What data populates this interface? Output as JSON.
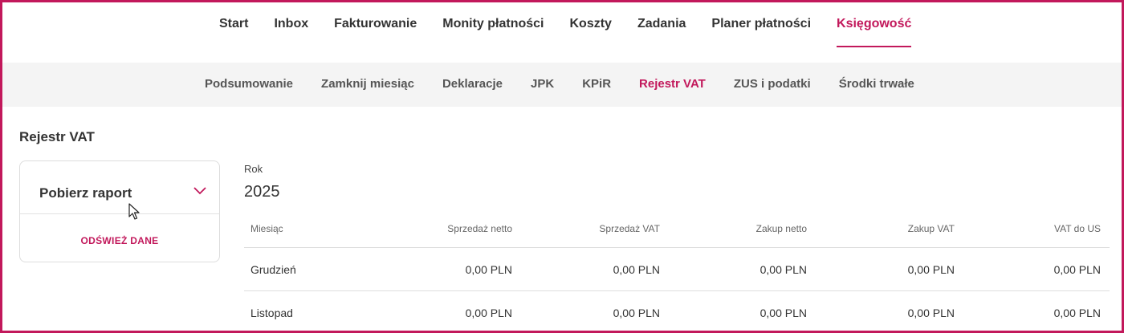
{
  "topnav": {
    "items": [
      {
        "label": "Start",
        "active": false
      },
      {
        "label": "Inbox",
        "active": false
      },
      {
        "label": "Fakturowanie",
        "active": false
      },
      {
        "label": "Monity płatności",
        "active": false
      },
      {
        "label": "Koszty",
        "active": false
      },
      {
        "label": "Zadania",
        "active": false
      },
      {
        "label": "Planer płatności",
        "active": false
      },
      {
        "label": "Księgowość",
        "active": true
      }
    ]
  },
  "subnav": {
    "items": [
      {
        "label": "Podsumowanie",
        "active": false
      },
      {
        "label": "Zamknij miesiąc",
        "active": false
      },
      {
        "label": "Deklaracje",
        "active": false
      },
      {
        "label": "JPK",
        "active": false
      },
      {
        "label": "KPiR",
        "active": false
      },
      {
        "label": "Rejestr VAT",
        "active": true
      },
      {
        "label": "ZUS i podatki",
        "active": false
      },
      {
        "label": "Środki trwałe",
        "active": false
      }
    ]
  },
  "page": {
    "title": "Rejestr VAT"
  },
  "report_card": {
    "title": "Pobierz raport",
    "chevron_icon": "chevron-down-icon",
    "refresh_label": "ODŚWIEŻ DANE"
  },
  "year": {
    "label": "Rok",
    "value": "2025"
  },
  "table": {
    "headers": [
      "Miesiąc",
      "Sprzedaż netto",
      "Sprzedaż VAT",
      "Zakup netto",
      "Zakup VAT",
      "VAT do US"
    ],
    "rows": [
      [
        "Grudzień",
        "0,00 PLN",
        "0,00 PLN",
        "0,00 PLN",
        "0,00 PLN",
        "0,00 PLN"
      ],
      [
        "Listopad",
        "0,00 PLN",
        "0,00 PLN",
        "0,00 PLN",
        "0,00 PLN",
        "0,00 PLN"
      ]
    ]
  },
  "colors": {
    "accent": "#c2185b",
    "subnav_bg": "#f4f4f4"
  }
}
